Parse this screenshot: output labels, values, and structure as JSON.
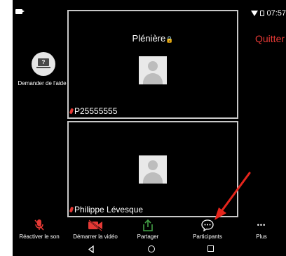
{
  "status": {
    "time": "07:57"
  },
  "meeting": {
    "quit_label": "Quitter",
    "help_label": "Demander de l'aide",
    "help_glyph": "?"
  },
  "tiles": [
    {
      "title": "Plénière",
      "title_lock": "🔒",
      "participant": "P25555555"
    },
    {
      "participant": "Philippe Lévesque"
    }
  ],
  "toolbar": {
    "unmute_label": "Réactiver le son",
    "start_video_label": "Démarrer la vidéo",
    "share_label": "Partager",
    "participants_label": "Participants",
    "more_label": "Plus",
    "more_glyph": "•••"
  },
  "colors": {
    "danger": "#e53935",
    "share_green": "#43a047",
    "background": "#000000"
  },
  "icons": [
    "camera-status-icon",
    "wifi-icon",
    "lock-icon",
    "help-laptop-icon",
    "mic-muted-icon",
    "video-off-icon",
    "share-icon",
    "chat-bubble-icon",
    "more-icon",
    "back-icon",
    "home-icon",
    "recents-icon",
    "red-arrow-annotation"
  ]
}
